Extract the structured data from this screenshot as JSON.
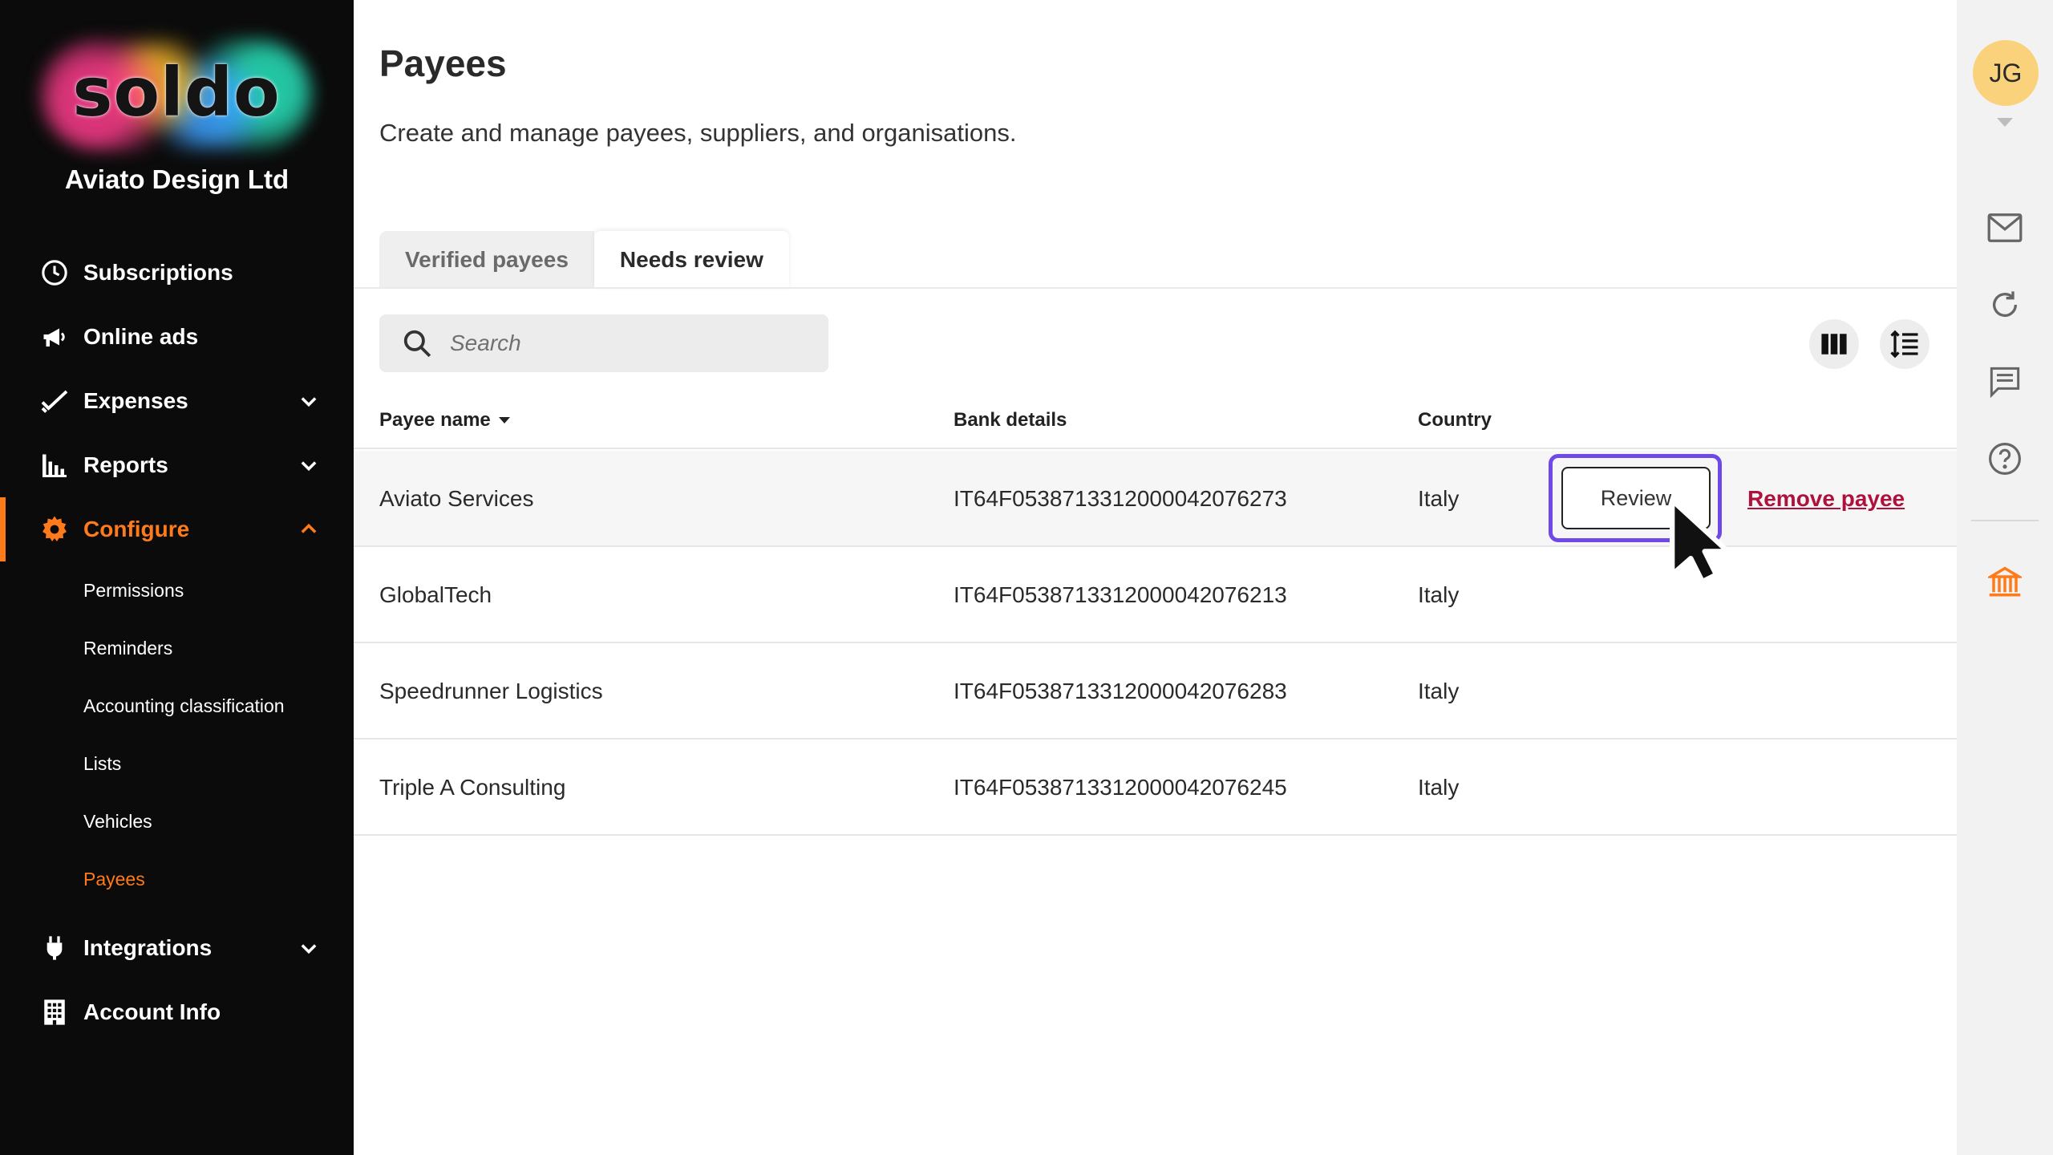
{
  "brand": {
    "logo_text": "soldo",
    "company": "Aviato Design Ltd"
  },
  "sidebar": {
    "items": [
      {
        "label": "Subscriptions",
        "icon": "clock-icon"
      },
      {
        "label": "Online ads",
        "icon": "megaphone-icon"
      },
      {
        "label": "Expenses",
        "icon": "checkmark-icon"
      },
      {
        "label": "Reports",
        "icon": "bar-chart-icon"
      },
      {
        "label": "Configure",
        "icon": "gear-icon"
      },
      {
        "label": "Integrations",
        "icon": "plug-icon"
      },
      {
        "label": "Account Info",
        "icon": "building-icon"
      }
    ],
    "configure_sub": [
      "Permissions",
      "Reminders",
      "Accounting classification",
      "Lists",
      "Vehicles",
      "Payees"
    ],
    "active_item": "Configure",
    "active_sub": "Payees",
    "accent_color": "#ff7a1a"
  },
  "page": {
    "title": "Payees",
    "subtitle": "Create and manage payees, suppliers, and organisations."
  },
  "tabs": [
    {
      "label": "Verified payees",
      "active": false
    },
    {
      "label": "Needs review",
      "active": true
    }
  ],
  "search": {
    "placeholder": "Search",
    "value": ""
  },
  "table": {
    "columns": [
      "Payee name",
      "Bank details",
      "Country"
    ],
    "rows": [
      {
        "name": "Aviato Services",
        "bank": "IT64F0538713312000042076273",
        "country": "Italy"
      },
      {
        "name": "GlobalTech",
        "bank": "IT64F0538713312000042076213",
        "country": "Italy"
      },
      {
        "name": "Speedrunner Logistics",
        "bank": "IT64F0538713312000042076283",
        "country": "Italy"
      },
      {
        "name": "Triple A Consulting",
        "bank": "IT64F0538713312000042076245",
        "country": "Italy"
      }
    ],
    "row_actions": {
      "review": "Review",
      "remove": "Remove payee"
    }
  },
  "user": {
    "initials": "JG",
    "avatar_color": "#fbd27c"
  },
  "rail_icons": [
    "mail-icon",
    "refresh-icon",
    "chat-icon",
    "help-icon",
    "bank-icon"
  ]
}
